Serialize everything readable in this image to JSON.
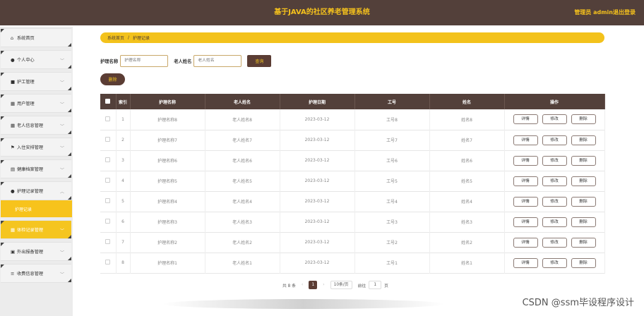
{
  "header": {
    "title": "基于JAVA的社区养老管理系统",
    "admin_label": "管理员 admin",
    "logout_label": "退出登录"
  },
  "sidebar": {
    "items": [
      {
        "icon": "home-icon",
        "label": "系统首页",
        "glyph": "⌂"
      },
      {
        "icon": "user-icon",
        "label": "个人中心",
        "glyph": "●"
      },
      {
        "icon": "briefcase-icon",
        "label": "护工管理",
        "glyph": "■"
      },
      {
        "icon": "grid-icon",
        "label": "用户管理",
        "glyph": "▦"
      },
      {
        "icon": "grid-icon",
        "label": "老人信息管理",
        "glyph": "▦"
      },
      {
        "icon": "flag-icon",
        "label": "入住安排管理",
        "glyph": "⚑"
      },
      {
        "icon": "table-icon",
        "label": "健康档案管理",
        "glyph": "▤"
      },
      {
        "icon": "user-icon",
        "label": "护理记录管理",
        "glyph": "●"
      },
      {
        "icon": "grid-icon",
        "label": "体检记录管理",
        "glyph": "▦"
      },
      {
        "icon": "document-icon",
        "label": "外出报备管理",
        "glyph": "▣"
      },
      {
        "icon": "sliders-icon",
        "label": "收费信息管理",
        "glyph": "≡"
      }
    ],
    "submenu_label": "护理记录"
  },
  "breadcrumb": {
    "home": "系统首页",
    "separator": "/",
    "current": "护理记录"
  },
  "search": {
    "field1_label": "护理名称",
    "field1_placeholder": "护理名称",
    "field2_label": "老人姓名",
    "field2_placeholder": "老人姓名",
    "query_label": "查询"
  },
  "delete_label": "删除",
  "table": {
    "headers": [
      "索引",
      "护理名称",
      "老人姓名",
      "护理日期",
      "工号",
      "姓名",
      "操作"
    ],
    "rows": [
      {
        "idx": "1",
        "name": "护理名称8",
        "elder": "老人姓名8",
        "date": "2023-03-12",
        "job": "工号8",
        "person": "姓名8"
      },
      {
        "idx": "2",
        "name": "护理名称7",
        "elder": "老人姓名7",
        "date": "2023-03-12",
        "job": "工号7",
        "person": "姓名7"
      },
      {
        "idx": "3",
        "name": "护理名称6",
        "elder": "老人姓名6",
        "date": "2023-03-12",
        "job": "工号6",
        "person": "姓名6"
      },
      {
        "idx": "4",
        "name": "护理名称5",
        "elder": "老人姓名5",
        "date": "2023-03-12",
        "job": "工号5",
        "person": "姓名5"
      },
      {
        "idx": "5",
        "name": "护理名称4",
        "elder": "老人姓名4",
        "date": "2023-03-12",
        "job": "工号4",
        "person": "姓名4"
      },
      {
        "idx": "6",
        "name": "护理名称3",
        "elder": "老人姓名3",
        "date": "2023-03-12",
        "job": "工号3",
        "person": "姓名3"
      },
      {
        "idx": "7",
        "name": "护理名称2",
        "elder": "老人姓名2",
        "date": "2023-03-12",
        "job": "工号2",
        "person": "姓名2"
      },
      {
        "idx": "8",
        "name": "护理名称1",
        "elder": "老人姓名1",
        "date": "2023-03-12",
        "job": "工号1",
        "person": "姓名1"
      }
    ],
    "actions": {
      "detail": "详情",
      "edit": "修改",
      "delete": "删除"
    }
  },
  "pager": {
    "total": "共 8 条",
    "prev": "‹",
    "current_page": "1",
    "next": "›",
    "page_size": "10条/页",
    "goto_label": "前往",
    "goto_value": "1",
    "page_suffix": "页"
  },
  "watermark": "CSDN @ssm毕设程序设计",
  "colors": {
    "header_bg": "#53403a",
    "accent_yellow": "#f3c21c",
    "button_brown": "#5b3d34"
  }
}
